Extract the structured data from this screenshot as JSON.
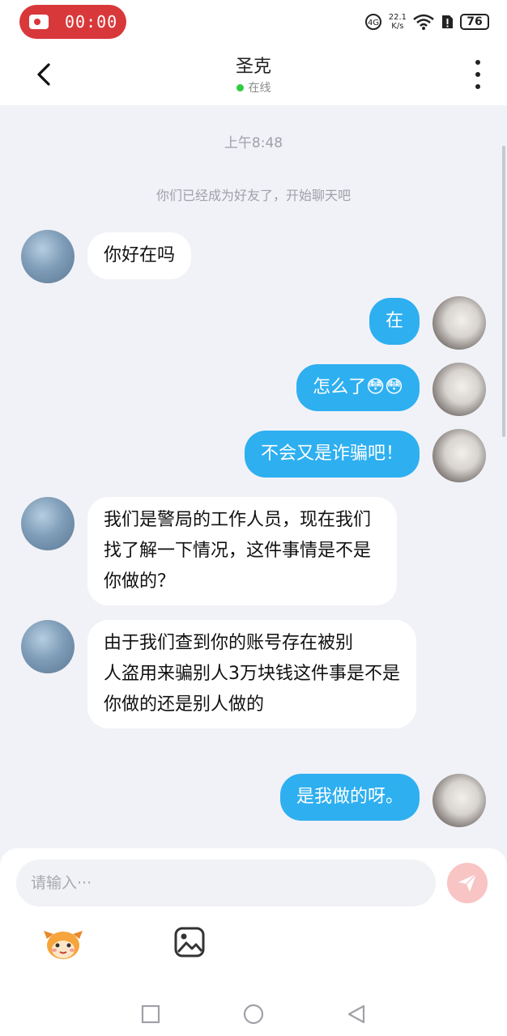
{
  "status_bar": {
    "recording_time": "00:00",
    "net_speed_value": "22.1",
    "net_speed_unit": "K/s",
    "battery": "76"
  },
  "header": {
    "contact_name": "圣克",
    "status": "在线"
  },
  "chat": {
    "time_label": "上午8:48",
    "system_notice": "你们已经成为好友了，开始聊天吧",
    "messages": [
      {
        "from": "other",
        "text": "你好在吗"
      },
      {
        "from": "me",
        "text": "在"
      },
      {
        "from": "me",
        "text": "怎么了😳😳"
      },
      {
        "from": "me",
        "text": "不会又是诈骗吧！"
      },
      {
        "from": "other",
        "text": "我们是警局的工作人员，现在我们找了解一下情况，这件事情是不是你做的？"
      },
      {
        "from": "other",
        "text": "由于我们查到你的账号存在被别\n人盗用来骗别人3万块钱这件事是不是你做的还是别人做的"
      },
      {
        "from": "me",
        "text": "是我做的呀。"
      }
    ]
  },
  "composer": {
    "placeholder": "请输入···"
  },
  "icons": {
    "back": "chevron-left-icon",
    "more": "more-vertical-icon",
    "send": "send-icon",
    "emoji": "emoji-icon",
    "image": "image-icon"
  },
  "colors": {
    "out_bubble": "#2eaff0",
    "recording": "#d9383b",
    "online": "#2ecc40"
  }
}
